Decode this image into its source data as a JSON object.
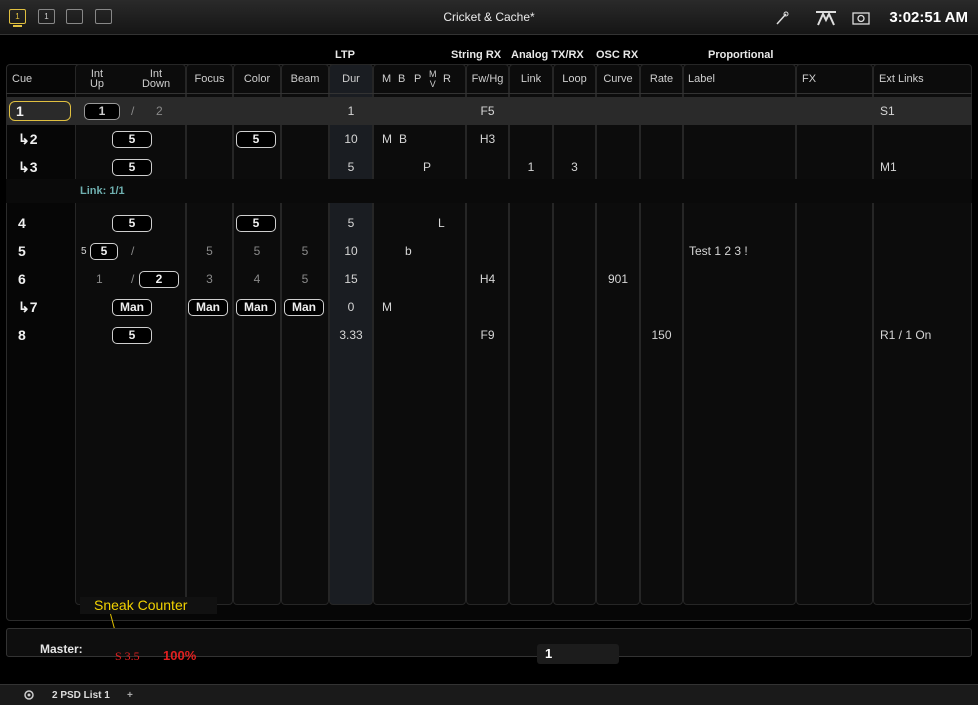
{
  "topbar": {
    "workspaces": [
      "1",
      "1",
      "",
      ""
    ],
    "title": "Cricket & Cache*",
    "icons": [
      "wand-icon",
      "eos-logo-icon",
      "camera-icon"
    ],
    "clock": "3:02:51 AM"
  },
  "groups": {
    "ltp": "LTP",
    "string_rx": "String RX",
    "analog": "Analog TX/RX",
    "osc": "OSC RX",
    "proportional": "Proportional"
  },
  "headers": {
    "cue": "Cue",
    "int_up": [
      "Int",
      "Up"
    ],
    "int_down": [
      "Int",
      "Down"
    ],
    "focus": "Focus",
    "color": "Color",
    "beam": "Beam",
    "dur": "Dur",
    "flags": [
      "M",
      "B",
      "P"
    ],
    "flags_mv": [
      "M",
      "V"
    ],
    "flag_r": "R",
    "fwhg": "Fw/Hg",
    "link": "Link",
    "loop": "Loop",
    "curve": "Curve",
    "rate": "Rate",
    "label": "Label",
    "fx": "FX",
    "ext": "Ext Links"
  },
  "rows": [
    {
      "cue": "1",
      "up": "1",
      "slash": "/",
      "down": "2",
      "dur": "1",
      "fwhg": "F5",
      "ext": "S1"
    },
    {
      "cue": "↳2",
      "up": "5",
      "color": "5",
      "dur": "10",
      "m": "M",
      "b": "B",
      "fwhg": "H3"
    },
    {
      "cue": "↳3",
      "up": "5",
      "dur": "5",
      "p": "P",
      "link": "1",
      "loop": "3",
      "ext": "M1"
    },
    {
      "cue": "4",
      "up": "5",
      "color": "5",
      "dur": "5",
      "l": "L"
    },
    {
      "cue": "5",
      "pre": "5",
      "up": "5",
      "slash": "/",
      "focus": "5",
      "color": "5",
      "beam": "5",
      "dur": "10",
      "b": "b",
      "label": "Test 1 2 3 !"
    },
    {
      "cue": "6",
      "up": "1",
      "slash": "/",
      "down": "2",
      "focus": "3",
      "color": "4",
      "beam": "5",
      "dur": "15",
      "fwhg": "H4",
      "curve": "901"
    },
    {
      "cue": "↳7",
      "up": "Man",
      "focus": "Man",
      "color": "Man",
      "beam": "Man",
      "dur": "0",
      "m": "M"
    },
    {
      "cue": "8",
      "up": "5",
      "dur": "3.33",
      "fwhg": "F9",
      "rate": "150",
      "ext": "R1 / 1 On"
    }
  ],
  "link_text": "Link: 1/1",
  "sneak": "Sneak Counter",
  "master": {
    "label": "Master:",
    "value": "S 3.5",
    "percent": "100%"
  },
  "command_line": "1",
  "tabs": {
    "list": "2 PSD List 1",
    "add": "+"
  }
}
